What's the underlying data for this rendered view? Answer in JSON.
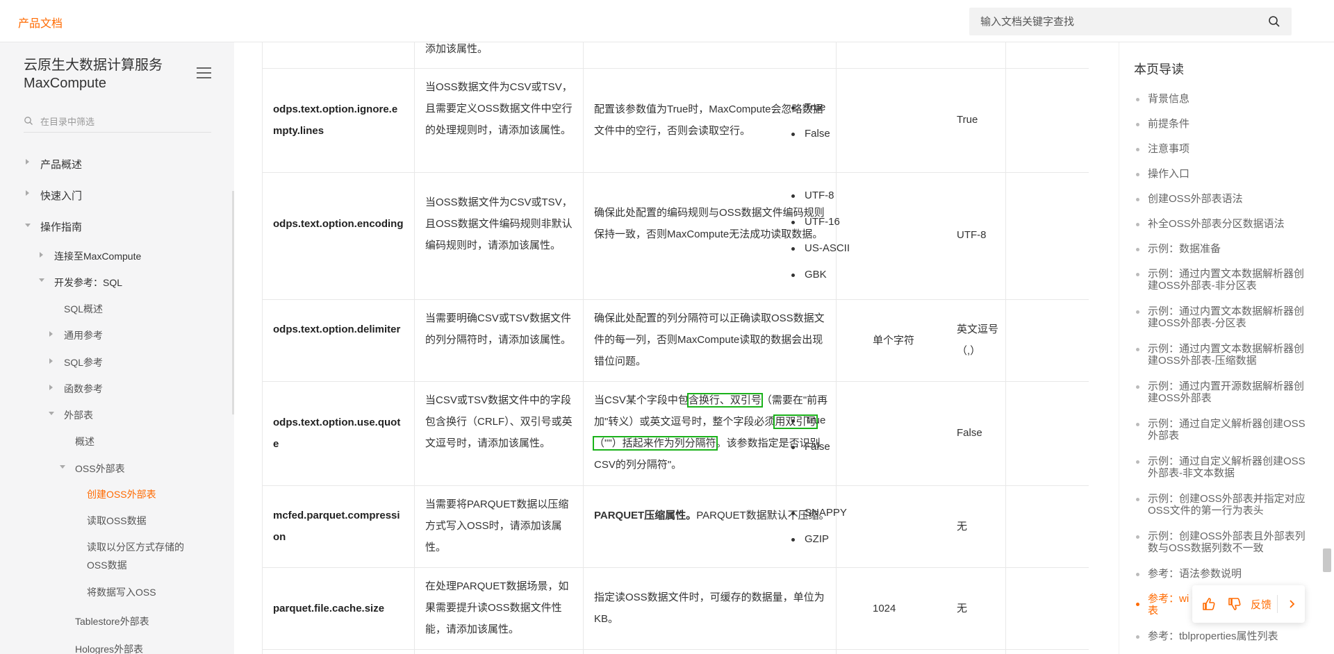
{
  "header": {
    "brand": "产品文档",
    "search_placeholder": "输入文档关键字查找"
  },
  "sidebar": {
    "title": "云原生大数据计算服务 MaxCompute",
    "filter_placeholder": "在目录中筛选",
    "items": [
      {
        "label": "产品概述"
      },
      {
        "label": "快速入门"
      },
      {
        "label": "操作指南"
      },
      {
        "label": "连接至MaxCompute"
      },
      {
        "label": "开发参考：SQL"
      },
      {
        "label": "SQL概述"
      },
      {
        "label": "通用参考"
      },
      {
        "label": "SQL参考"
      },
      {
        "label": "函数参考"
      },
      {
        "label": "外部表"
      },
      {
        "label": "概述"
      },
      {
        "label": "OSS外部表"
      },
      {
        "label": "创建OSS外部表"
      },
      {
        "label": "读取OSS数据"
      },
      {
        "label": "读取以分区方式存储的OSS数据"
      },
      {
        "label": "将数据写入OSS"
      },
      {
        "label": "Tablestore外部表"
      },
      {
        "label": "Hologres外部表"
      }
    ]
  },
  "table": {
    "top_fragment": "添加该属性。",
    "rows": [
      {
        "param": "odps.text.option.ignore.empty.lines",
        "scene": "当OSS数据文件为CSV或TSV，且需要定义OSS数据文件中空行的处理规则时，请添加该属性。",
        "desc": "配置该参数值为True时，MaxCompute会忽略数据文件中的空行，否则会读取空行。",
        "values": [
          "True",
          "False"
        ],
        "default": "True"
      },
      {
        "param": "odps.text.option.encoding",
        "scene": "当OSS数据文件为CSV或TSV，且OSS数据文件编码规则非默认编码规则时，请添加该属性。",
        "desc": "确保此处配置的编码规则与OSS数据文件编码规则保持一致，否则MaxCompute无法成功读取数据。",
        "values": [
          "UTF-8",
          "UTF-16",
          "US-ASCII",
          "GBK"
        ],
        "default": "UTF-8"
      },
      {
        "param": "odps.text.option.delimiter",
        "scene": "当需要明确CSV或TSV数据文件的列分隔符时，请添加该属性。",
        "desc": "确保此处配置的列分隔符可以正确读取OSS数据文件的每一列，否则MaxCompute读取的数据会出现错位问题。",
        "value_text": "单个字符",
        "default": "英文逗号（,）"
      },
      {
        "param": "odps.text.option.use.quote",
        "scene": "当CSV或TSV数据文件中的字段包含换行（CRLF）、双引号或英文逗号时，请添加该属性。",
        "desc_parts": [
          "当CSV某个字段中包",
          "含换行、双引号",
          "（需要在\"前再加\"转义）或英文逗号时，整个字段必须",
          "用双引号（\"\"）括起来作为列分隔符",
          "。该参数指定是否识别CSV的列分隔符\"。"
        ],
        "values": [
          "True",
          "False"
        ],
        "default": "False"
      },
      {
        "param": "mcfed.parquet.compression",
        "scene": "当需要将PARQUET数据以压缩方式写入OSS时，请添加该属性。",
        "desc_bold": "PARQUET压缩属性。",
        "desc": "PARQUET数据默认不压缩。",
        "values": [
          "SNAPPY",
          "GZIP"
        ],
        "default": "无"
      },
      {
        "param": "parquet.file.cache.size",
        "scene": "在处理PARQUET数据场景，如果需要提升读OSS数据文件性能，请添加该属性。",
        "desc": "指定读OSS数据文件时，可缓存的数据量，单位为KB。",
        "value_text": "1024",
        "default": "无"
      }
    ]
  },
  "toc": {
    "title": "本页导读",
    "items": [
      "背景信息",
      "前提条件",
      "注意事项",
      "操作入口",
      "创建OSS外部表语法",
      "补全OSS外部表分区数据语法",
      "示例：数据准备",
      "示例：通过内置文本数据解析器创建OSS外部表-非分区表",
      "示例：通过内置文本数据解析器创建OSS外部表-分区表",
      "示例：通过内置文本数据解析器创建OSS外部表-压缩数据",
      "示例：通过内置开源数据解析器创建OSS外部表",
      "示例：通过自定义解析器创建OSS外部表",
      "示例：通过自定义解析器创建OSS外部表-非文本数据",
      "示例：创建OSS外部表并指定对应OSS文件的第一行为表头",
      "示例：创建OSS外部表且外部表列数与OSS数据列数不一致",
      "参考：语法参数说明",
      "参考：with serdeproperties属性列表",
      "参考：tblproperties属性列表"
    ],
    "active_visible": "参考：wi 性列表"
  },
  "feedback": {
    "label": "反馈"
  },
  "colors": {
    "accent": "#ff6a00",
    "highlight": "#1ab21a"
  }
}
